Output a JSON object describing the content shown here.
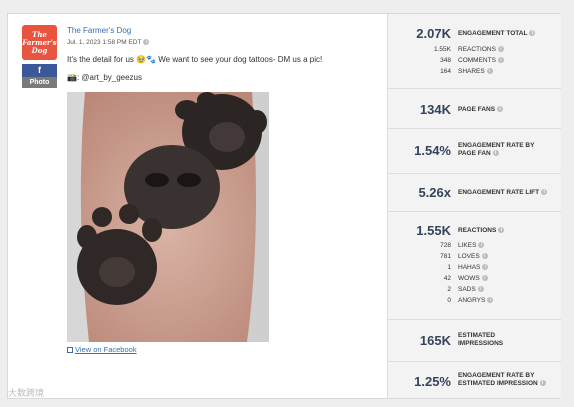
{
  "post": {
    "logo_text": "The Farmer's Dog",
    "fb_badge": "f",
    "type_badge": "Photo",
    "page_name": "The Farmer's Dog",
    "date": "Jul. 1, 2023 1:58 PM EDT",
    "message": "It's the detail for us 🥹🐾 We want to see your dog tattoos- DM us a pic!",
    "credit": "📸: @art_by_geezus",
    "view_link": "View on Facebook"
  },
  "metrics": {
    "engagement_total": {
      "value": "2.07K",
      "label": "ENGAGEMENT TOTAL"
    },
    "engagement_breakdown": [
      {
        "value": "1.55K",
        "label": "REACTIONS"
      },
      {
        "value": "348",
        "label": "COMMENTS"
      },
      {
        "value": "164",
        "label": "SHARES"
      }
    ],
    "page_fans": {
      "value": "134K",
      "label": "PAGE FANS"
    },
    "engagement_rate_fan": {
      "value": "1.54%",
      "label_line1": "ENGAGEMENT RATE BY",
      "label_line2": "PAGE FAN"
    },
    "engagement_rate_lift": {
      "value": "5.26x",
      "label": "ENGAGEMENT RATE LIFT"
    },
    "reactions": {
      "value": "1.55K",
      "label": "REACTIONS"
    },
    "reaction_breakdown": [
      {
        "value": "728",
        "label": "LIKES"
      },
      {
        "value": "781",
        "label": "LOVES"
      },
      {
        "value": "1",
        "label": "HAHAS"
      },
      {
        "value": "42",
        "label": "WOWS"
      },
      {
        "value": "2",
        "label": "SADS"
      },
      {
        "value": "0",
        "label": "ANGRYS"
      }
    ],
    "impressions": {
      "value": "165K",
      "label_line1": "ESTIMATED",
      "label_line2": "IMPRESSIONS"
    },
    "engagement_rate_impression": {
      "value": "1.25%",
      "label_line1": "ENGAGEMENT RATE BY",
      "label_line2": "ESTIMATED IMPRESSION"
    }
  },
  "watermark": "大数跨境",
  "colors": {
    "brand": "#e8543f",
    "facebook": "#3b5998",
    "link": "#3b6ea8",
    "metric": "#33445c"
  }
}
